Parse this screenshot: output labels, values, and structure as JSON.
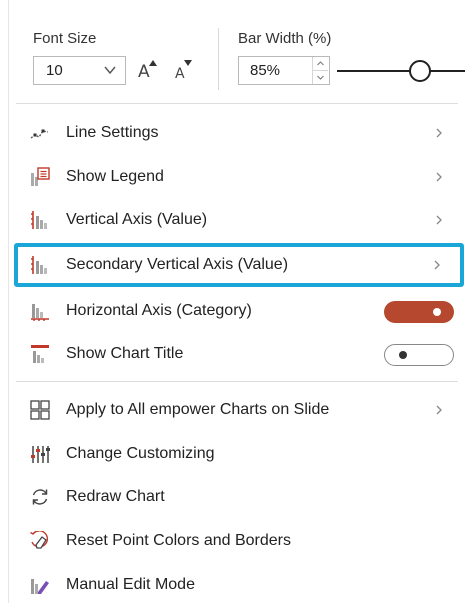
{
  "font_size": {
    "label": "Font Size",
    "value": "10",
    "grow_icon": "A",
    "shrink_icon": "A"
  },
  "bar_width": {
    "label": "Bar Width (%)",
    "value": "85%",
    "slider_level_percent": 85
  },
  "menu": {
    "line_settings": "Line Settings",
    "show_legend": "Show Legend",
    "vertical_axis": "Vertical Axis (Value)",
    "secondary_vertical_axis": "Secondary Vertical Axis (Value)",
    "horizontal_axis": "Horizontal Axis (Category)",
    "show_chart_title": "Show Chart Title",
    "apply_all": "Apply to All empower Charts on Slide",
    "change_customizing": "Change Customizing",
    "redraw_chart": "Redraw Chart",
    "reset_point_colors": "Reset Point Colors and Borders",
    "manual_edit": "Manual Edit Mode"
  },
  "toggles": {
    "horizontal_axis_on": true,
    "show_chart_title_on": false
  },
  "colors": {
    "highlight": "#1aa6d6",
    "toggle_on": "#b5482e",
    "icon_red": "#c0392b",
    "icon_gray": "#8a8a8a"
  }
}
